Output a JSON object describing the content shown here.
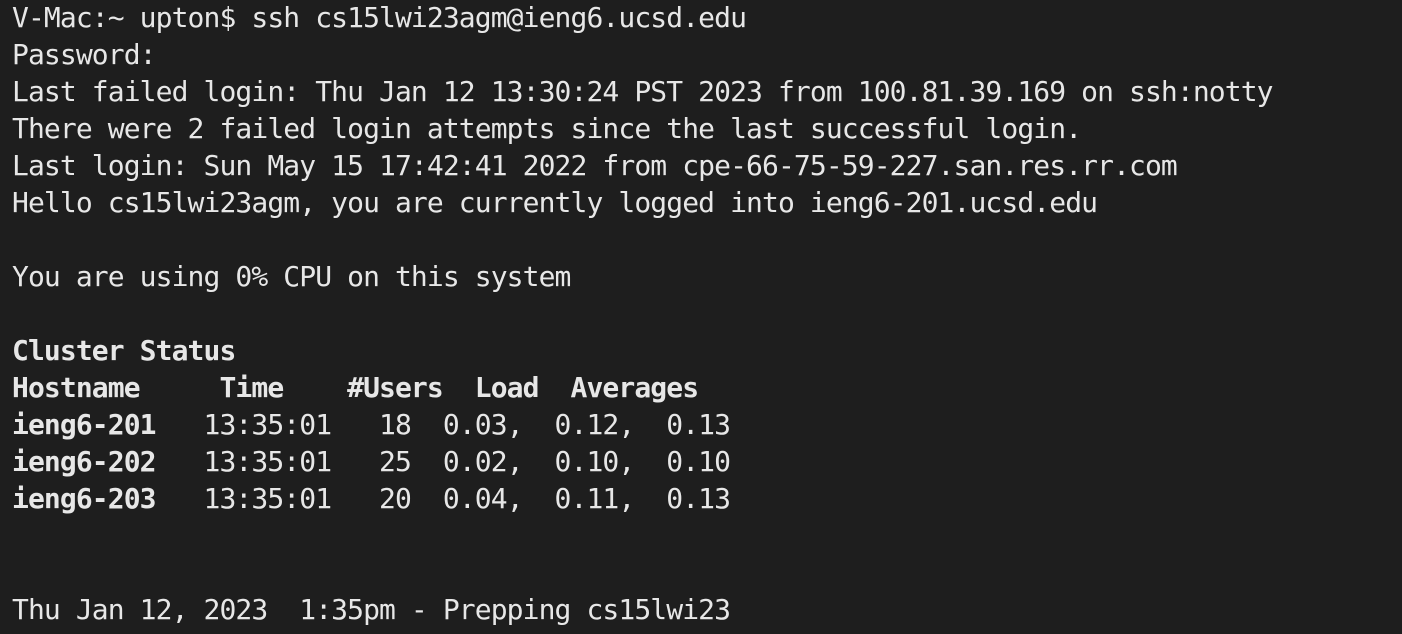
{
  "terminal": {
    "background": "#1e1e1e",
    "foreground": "#e7e7e7",
    "lines": [
      "V-Mac:~ upton$ ssh cs15lwi23agm@ieng6.ucsd.edu",
      "Password:",
      "Last failed login: Thu Jan 12 13:30:24 PST 2023 from 100.81.39.169 on ssh:notty",
      "There were 2 failed login attempts since the last successful login.",
      "Last login: Sun May 15 17:42:41 2022 from cpe-66-75-59-227.san.res.rr.com",
      "Hello cs15lwi23agm, you are currently logged into ieng6-201.ucsd.edu",
      "",
      "You are using 0% CPU on this system",
      "",
      "Cluster Status",
      "Hostname     Time    #Users  Load  Averages",
      "ieng6-201   13:35:01   18  0.03,  0.12,  0.13",
      "ieng6-202   13:35:01   25  0.02,  0.10,  0.10",
      "ieng6-203   13:35:01   20  0.04,  0.11,  0.13",
      "",
      "",
      "Thu Jan 12, 2023  1:35pm - Prepping cs15lwi23"
    ]
  }
}
